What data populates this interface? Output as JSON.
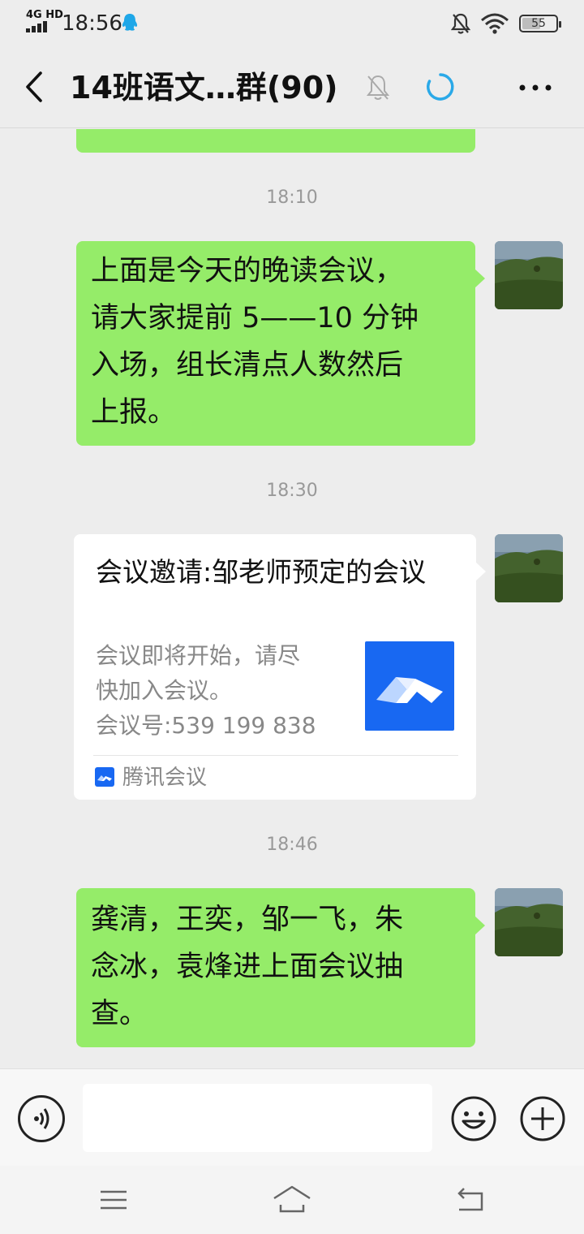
{
  "status_bar": {
    "network": "4G HD",
    "time": "18:56",
    "battery": "55",
    "battery_level": 0.55
  },
  "header": {
    "title": "14班语文…群(90)",
    "icons": [
      "back-icon",
      "mute-bell-icon",
      "loading-ring-icon",
      "more-icon"
    ],
    "accent_color": "#2aa9e8"
  },
  "colors": {
    "own_bubble": "#95ec69",
    "background": "#ededed",
    "card_bg": "#ffffff",
    "meeting_blue": "#1868f2"
  },
  "messages": [
    {
      "time": "18:10",
      "lines": [
        "上面是今天的晚读会议，",
        "请大家提前 5——10 分钟",
        "入场，组长清点人数然后",
        "上报。"
      ]
    },
    {
      "time": "18:30",
      "card": {
        "title": "会议邀请:邹老师预定的会议",
        "desc_lines": [
          "会议即将开始，请尽",
          "快加入会议。",
          "会议号:539 199 838"
        ],
        "source": "腾讯会议"
      }
    },
    {
      "time": "18:46",
      "lines": [
        "龚清，王奕，邹一飞，朱",
        "念冰，袁烽进上面会议抽",
        "查。"
      ]
    }
  ],
  "input_bar": {
    "icons": [
      "voice-icon",
      "emoji-icon",
      "plus-icon"
    ]
  },
  "nav_bar": {
    "icons": [
      "menu-icon",
      "home-icon",
      "back-nav-icon"
    ]
  }
}
